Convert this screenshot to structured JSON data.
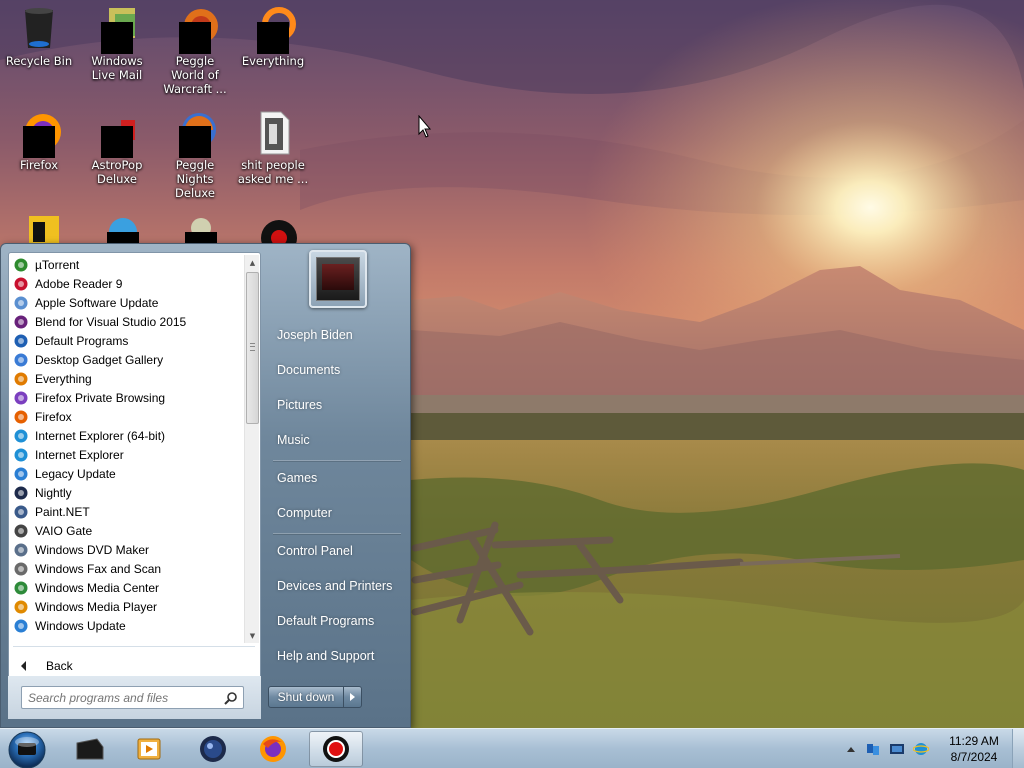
{
  "desktop": {
    "icons": [
      {
        "label": "Recycle Bin",
        "icon": "recycle-bin-icon"
      },
      {
        "label": "Windows Live Mail",
        "icon": "windows-live-mail-icon"
      },
      {
        "label": "Peggle World of Warcraft ...",
        "icon": "peggle-world-of-warcraft-icon"
      },
      {
        "label": "Everything",
        "icon": "everything-search-icon"
      },
      {
        "label": "Firefox",
        "icon": "firefox-icon"
      },
      {
        "label": "AstroPop Deluxe",
        "icon": "astropop-deluxe-icon"
      },
      {
        "label": "Peggle Nights Deluxe",
        "icon": "peggle-nights-deluxe-icon"
      },
      {
        "label": "shit people asked me ...",
        "icon": "text-document-icon"
      }
    ]
  },
  "start_menu": {
    "programs": [
      {
        "label": "µTorrent",
        "icon": "utorrent-icon",
        "color": "#2e8b2e"
      },
      {
        "label": "Adobe Reader 9",
        "icon": "adobe-reader-icon",
        "color": "#c8102e"
      },
      {
        "label": "Apple Software Update",
        "icon": "apple-software-update-icon",
        "color": "#5a8fd0"
      },
      {
        "label": "Blend for Visual Studio 2015",
        "icon": "blend-icon",
        "color": "#68217a"
      },
      {
        "label": "Default Programs",
        "icon": "default-programs-icon",
        "color": "#1e5fb3"
      },
      {
        "label": "Desktop Gadget Gallery",
        "icon": "gadget-gallery-icon",
        "color": "#3a7bd5"
      },
      {
        "label": "Everything",
        "icon": "everything-icon",
        "color": "#e07b00"
      },
      {
        "label": "Firefox Private Browsing",
        "icon": "firefox-private-icon",
        "color": "#7b3fbf"
      },
      {
        "label": "Firefox",
        "icon": "firefox-icon",
        "color": "#e66000"
      },
      {
        "label": "Internet Explorer (64-bit)",
        "icon": "internet-explorer-icon",
        "color": "#1e90d6"
      },
      {
        "label": "Internet Explorer",
        "icon": "internet-explorer-icon",
        "color": "#1e90d6"
      },
      {
        "label": "Legacy Update",
        "icon": "legacy-update-icon",
        "color": "#2a7fd4"
      },
      {
        "label": "Nightly",
        "icon": "nightly-icon",
        "color": "#1d2a4a"
      },
      {
        "label": "Paint.NET",
        "icon": "paint-net-icon",
        "color": "#3a5a8a"
      },
      {
        "label": "VAIO Gate",
        "icon": "vaio-gate-icon",
        "color": "#444444"
      },
      {
        "label": "Windows DVD Maker",
        "icon": "dvd-maker-icon",
        "color": "#5a6f8a"
      },
      {
        "label": "Windows Fax and Scan",
        "icon": "fax-scan-icon",
        "color": "#6a6a6a"
      },
      {
        "label": "Windows Media Center",
        "icon": "media-center-icon",
        "color": "#2e8b3a"
      },
      {
        "label": "Windows Media Player",
        "icon": "media-player-icon",
        "color": "#e08a00"
      },
      {
        "label": "Windows Update",
        "icon": "windows-update-icon",
        "color": "#2a7fd4"
      }
    ],
    "back_label": "Back",
    "search_placeholder": "Search programs and files",
    "right_items": [
      {
        "label": "Joseph Biden"
      },
      {
        "label": "Documents"
      },
      {
        "label": "Pictures"
      },
      {
        "label": "Music"
      },
      {
        "label": "Games"
      },
      {
        "label": "Computer"
      },
      {
        "label": "Control Panel"
      },
      {
        "label": "Devices and Printers"
      },
      {
        "label": "Default Programs"
      },
      {
        "label": "Help and Support"
      }
    ],
    "shutdown_label": "Shut down"
  },
  "taskbar": {
    "pinned": [
      {
        "icon": "vaio-app-icon"
      },
      {
        "icon": "media-player-classic-icon"
      },
      {
        "icon": "nightly-icon"
      },
      {
        "icon": "firefox-icon"
      },
      {
        "icon": "screen-recorder-icon",
        "active": true
      }
    ],
    "clock_time": "11:29 AM",
    "clock_date": "8/7/2024"
  }
}
